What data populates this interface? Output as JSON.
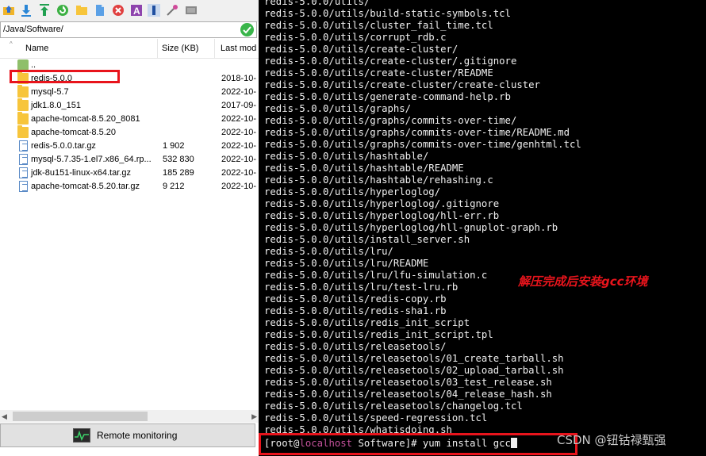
{
  "toolbar": {
    "icons": [
      "folder-up-icon",
      "download-icon",
      "upload-icon",
      "refresh-icon",
      "new-folder-icon",
      "new-file-icon",
      "delete-icon",
      "rename-icon",
      "properties-icon",
      "settings-icon",
      "terminal-icon"
    ]
  },
  "path": {
    "value": "/Java/Software/"
  },
  "columns": {
    "name": "Name",
    "size": "Size (KB)",
    "modified": "Last modi"
  },
  "files": [
    {
      "name": "..",
      "size": "",
      "modified": "",
      "type": "parent"
    },
    {
      "name": "redis-5.0.0",
      "size": "",
      "modified": "2018-10-",
      "type": "folder"
    },
    {
      "name": "mysql-5.7",
      "size": "",
      "modified": "2022-10-",
      "type": "folder"
    },
    {
      "name": "jdk1.8.0_151",
      "size": "",
      "modified": "2017-09-",
      "type": "folder"
    },
    {
      "name": "apache-tomcat-8.5.20_8081",
      "size": "",
      "modified": "2022-10-",
      "type": "folder"
    },
    {
      "name": "apache-tomcat-8.5.20",
      "size": "",
      "modified": "2022-10-",
      "type": "folder"
    },
    {
      "name": "redis-5.0.0.tar.gz",
      "size": "1 902",
      "modified": "2022-10-",
      "type": "file"
    },
    {
      "name": "mysql-5.7.35-1.el7.x86_64.rp...",
      "size": "532 830",
      "modified": "2022-10-",
      "type": "file"
    },
    {
      "name": "jdk-8u151-linux-x64.tar.gz",
      "size": "185 289",
      "modified": "2022-10-",
      "type": "file"
    },
    {
      "name": "apache-tomcat-8.5.20.tar.gz",
      "size": "9 212",
      "modified": "2022-10-",
      "type": "file"
    }
  ],
  "monitor": {
    "label": "Remote monitoring"
  },
  "terminal": {
    "lines": [
      "redis-5.0.0/utils/",
      "redis-5.0.0/utils/build-static-symbols.tcl",
      "redis-5.0.0/utils/cluster_fail_time.tcl",
      "redis-5.0.0/utils/corrupt_rdb.c",
      "redis-5.0.0/utils/create-cluster/",
      "redis-5.0.0/utils/create-cluster/.gitignore",
      "redis-5.0.0/utils/create-cluster/README",
      "redis-5.0.0/utils/create-cluster/create-cluster",
      "redis-5.0.0/utils/generate-command-help.rb",
      "redis-5.0.0/utils/graphs/",
      "redis-5.0.0/utils/graphs/commits-over-time/",
      "redis-5.0.0/utils/graphs/commits-over-time/README.md",
      "redis-5.0.0/utils/graphs/commits-over-time/genhtml.tcl",
      "redis-5.0.0/utils/hashtable/",
      "redis-5.0.0/utils/hashtable/README",
      "redis-5.0.0/utils/hashtable/rehashing.c",
      "redis-5.0.0/utils/hyperloglog/",
      "redis-5.0.0/utils/hyperloglog/.gitignore",
      "redis-5.0.0/utils/hyperloglog/hll-err.rb",
      "redis-5.0.0/utils/hyperloglog/hll-gnuplot-graph.rb",
      "redis-5.0.0/utils/install_server.sh",
      "redis-5.0.0/utils/lru/",
      "redis-5.0.0/utils/lru/README",
      "redis-5.0.0/utils/lru/lfu-simulation.c",
      "redis-5.0.0/utils/lru/test-lru.rb",
      "redis-5.0.0/utils/redis-copy.rb",
      "redis-5.0.0/utils/redis-sha1.rb",
      "redis-5.0.0/utils/redis_init_script",
      "redis-5.0.0/utils/redis_init_script.tpl",
      "redis-5.0.0/utils/releasetools/",
      "redis-5.0.0/utils/releasetools/01_create_tarball.sh",
      "redis-5.0.0/utils/releasetools/02_upload_tarball.sh",
      "redis-5.0.0/utils/releasetools/03_test_release.sh",
      "redis-5.0.0/utils/releasetools/04_release_hash.sh",
      "redis-5.0.0/utils/releasetools/changelog.tcl",
      "redis-5.0.0/utils/speed-regression.tcl",
      "redis-5.0.0/utils/whatisdoing.sh"
    ],
    "prompt_user": "[root@",
    "prompt_host": "localhost",
    "prompt_rest": " Software]# ",
    "command": "yum install gcc"
  },
  "annotation": "解压完成后安装gcc环境",
  "watermark": "CSDN @钮钴禄甄强",
  "colors": {
    "highlight": "#e8141c",
    "host": "#c4529c",
    "terminal_bg": "#000000",
    "folder": "#f7c53b"
  }
}
